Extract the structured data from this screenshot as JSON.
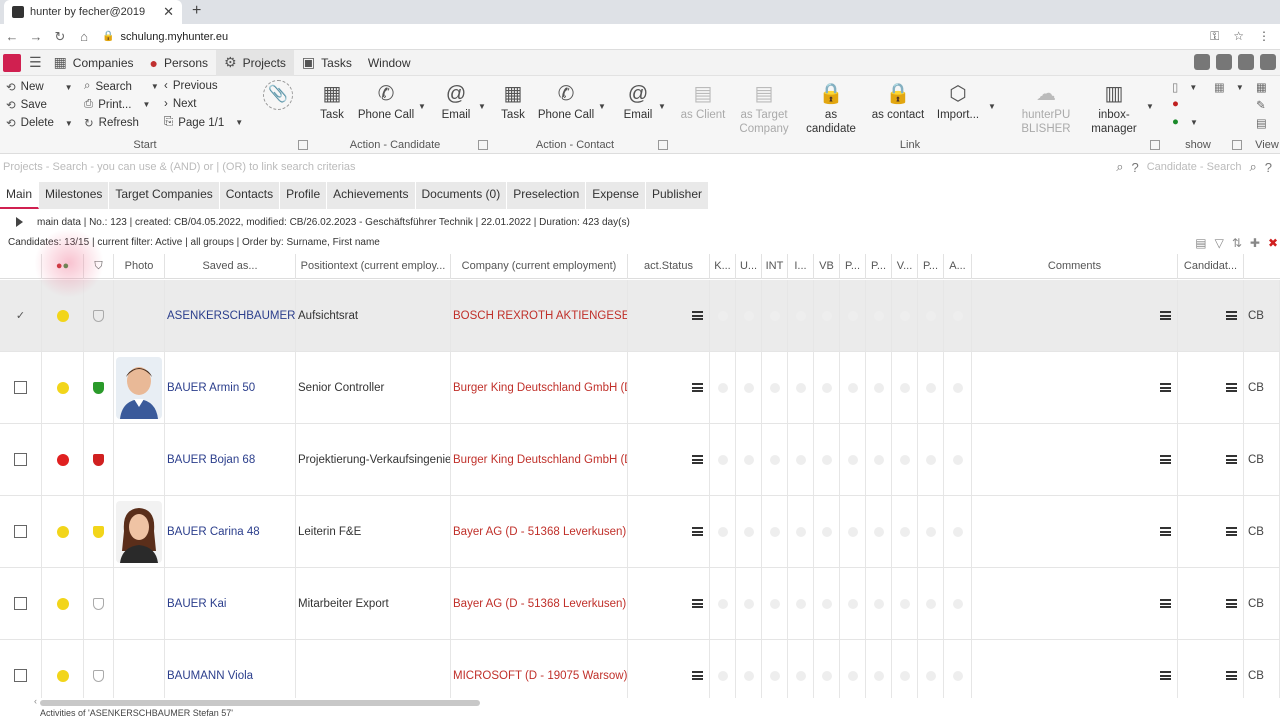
{
  "browser": {
    "tab_title": "hunter by fecher@2019",
    "url": "schulung.myhunter.eu"
  },
  "menu": {
    "items": [
      {
        "label": "Companies",
        "icon": "building-icon"
      },
      {
        "label": "Persons",
        "icon": "person-icon"
      },
      {
        "label": "Projects",
        "icon": "projects-icon"
      },
      {
        "label": "Tasks",
        "icon": "tasks-icon"
      },
      {
        "label": "Window",
        "icon": ""
      }
    ]
  },
  "ribbon": {
    "start": {
      "new": "New",
      "save": "Save",
      "delete": "Delete",
      "search": "Search",
      "print": "Print...",
      "refresh": "Refresh",
      "previous": "Previous",
      "next": "Next",
      "page": "Page 1/1",
      "label": "Start"
    },
    "action_candidate": {
      "task": "Task",
      "phone": "Phone Call",
      "email": "Email",
      "label": "Action - Candidate"
    },
    "action_contact": {
      "task": "Task",
      "phone": "Phone Call",
      "email": "Email",
      "label": "Action - Contact"
    },
    "link": {
      "as_client": "as Client",
      "as_target_1": "as Target",
      "as_target_2": "Company",
      "as_candidate_1": "as",
      "as_candidate_2": "candidate",
      "as_contact": "as contact",
      "import": "Import...",
      "label": "Link"
    },
    "extra": {
      "publisher_1": "hunterPU",
      "publisher_2": "BLISHER",
      "inbox_1": "inbox-",
      "inbox_2": "manager"
    },
    "show_label": "show",
    "view_label": "View"
  },
  "search": {
    "placeholder": "Projects - Search - you can use & (AND) or | (OR) to link search criterias",
    "candidate_placeholder": "Candidate - Search"
  },
  "subtabs": [
    "Main",
    "Milestones",
    "Target Companies",
    "Contacts",
    "Profile",
    "Achievements",
    "Documents (0)",
    "Preselection",
    "Expense",
    "Publisher"
  ],
  "info_line": "main data | No.: 123 | created: CB/04.05.2022, modified: CB/26.02.2023 - Geschäftsführer Technik | 22.01.2022 | Duration: 423 day(s)",
  "filter_line": "Candidates: 13/15 | current filter: Active | all groups | Order by: Surname, First name",
  "grid": {
    "headers": {
      "photo": "Photo",
      "saved_as": "Saved as...",
      "position": "Positiontext (current employ...",
      "company": "Company (current employment)",
      "status": "act.Status",
      "k": "K...",
      "u": "U...",
      "int": "INT",
      "i": "I...",
      "vb": "VB",
      "p1": "P...",
      "p2": "P...",
      "v": "V...",
      "p3": "P...",
      "a": "A...",
      "comments": "Comments",
      "candidate": "Candidat..."
    },
    "rows": [
      {
        "name": "ASENKERSCHBAUMER Ste",
        "position": "Aufsichtsrat",
        "company": "BOSCH REXROTH AKTIENGESELLSCH",
        "dot": "#f2d51a",
        "shield": "outline",
        "photo": "",
        "code": "CB",
        "selected": true
      },
      {
        "name": "BAUER Armin 50",
        "position": "Senior Controller",
        "company": "Burger King Deutschland GmbH (D -",
        "dot": "#f2d51a",
        "shield": "#2a9a2a",
        "photo": "male",
        "code": "CB",
        "selected": false
      },
      {
        "name": "BAUER Bojan 68",
        "position": "Projektierung-Verkaufsingenieur",
        "company": "Burger King Deutschland GmbH (D -",
        "dot": "#e02020",
        "shield": "#d02020",
        "photo": "",
        "code": "CB",
        "selected": false
      },
      {
        "name": "BAUER Carina 48",
        "position": "Leiterin F&E",
        "company": "Bayer AG (D - 51368 Leverkusen)",
        "dot": "#f2d51a",
        "shield": "#f2d51a",
        "photo": "female",
        "code": "CB",
        "selected": false
      },
      {
        "name": "BAUER Kai",
        "position": "Mitarbeiter Export",
        "company": "Bayer AG (D - 51368 Leverkusen)",
        "dot": "#f2d51a",
        "shield": "outline",
        "photo": "",
        "code": "CB",
        "selected": false
      },
      {
        "name": "BAUMANN Viola",
        "position": "",
        "company": "MICROSOFT (D - 19075 Warsow)",
        "dot": "#f2d51a",
        "shield": "outline",
        "photo": "",
        "code": "CB",
        "selected": false
      }
    ]
  },
  "footer": "Activities of 'ASENKERSCHBAUMER Stefan 57'"
}
